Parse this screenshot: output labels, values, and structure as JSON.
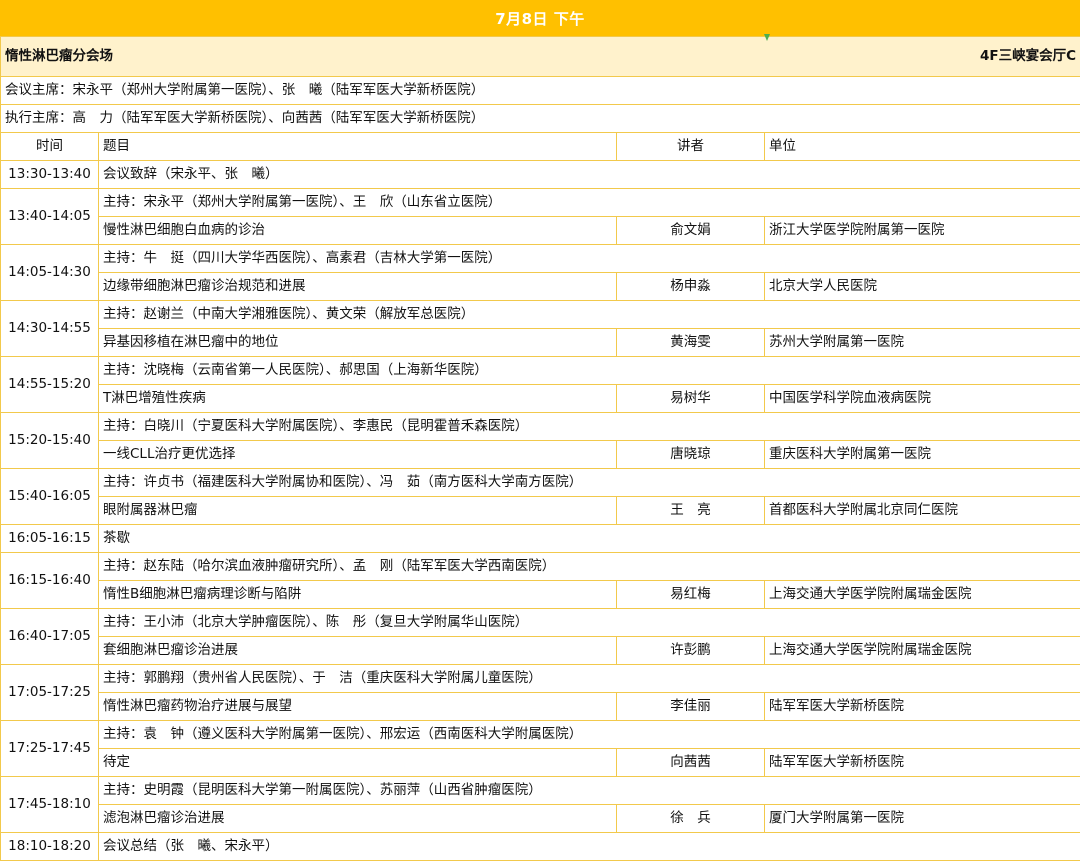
{
  "header": {
    "date_label": "7月8日  下午"
  },
  "session": {
    "title": "惰性淋巴瘤分会场",
    "room": "4F三峡宴会厅C"
  },
  "chairs": {
    "meeting_chairs": "会议主席：宋永平（郑州大学附属第一医院）、张　曦（陆军军医大学新桥医院）",
    "executive_chairs": "执行主席：高　力（陆军军医大学新桥医院）、向茜茜（陆军军医大学新桥医院）"
  },
  "columns": {
    "time": "时间",
    "topic": "题目",
    "speaker": "讲者",
    "unit": "单位"
  },
  "rows": [
    {
      "type": "single",
      "time": "13:30-13:40",
      "text": "会议致辞（宋永平、张　曦）"
    },
    {
      "type": "block",
      "time": "13:40-14:05",
      "host": "主持：宋永平（郑州大学附属第一医院）、王　欣（山东省立医院）",
      "topic": "慢性淋巴细胞白血病的诊治",
      "speaker": "俞文娟",
      "unit": "浙江大学医学院附属第一医院"
    },
    {
      "type": "block",
      "time": "14:05-14:30",
      "host": "主持：牛　挺（四川大学华西医院）、高素君（吉林大学第一医院）",
      "topic": "边缘带细胞淋巴瘤诊治规范和进展",
      "speaker": "杨申淼",
      "unit": "北京大学人民医院"
    },
    {
      "type": "block",
      "time": "14:30-14:55",
      "host": "主持：赵谢兰（中南大学湘雅医院）、黄文荣（解放军总医院）",
      "topic": "异基因移植在淋巴瘤中的地位",
      "speaker": "黄海雯",
      "unit": "苏州大学附属第一医院"
    },
    {
      "type": "block",
      "time": "14:55-15:20",
      "host": "主持：沈晓梅（云南省第一人民医院）、郝思国（上海新华医院）",
      "topic": "T淋巴增殖性疾病",
      "speaker": "易树华",
      "unit": "中国医学科学院血液病医院"
    },
    {
      "type": "block",
      "time": "15:20-15:40",
      "host": "主持：白晓川（宁夏医科大学附属医院）、李惠民（昆明霍普禾森医院）",
      "topic": "一线CLL治疗更优选择",
      "speaker": "唐晓琼",
      "unit": "重庆医科大学附属第一医院"
    },
    {
      "type": "block",
      "time": "15:40-16:05",
      "host": "主持：许贞书（福建医科大学附属协和医院）、冯　茹（南方医科大学南方医院）",
      "topic": "眼附属器淋巴瘤",
      "speaker": "王　亮",
      "unit": "首都医科大学附属北京同仁医院"
    },
    {
      "type": "single",
      "time": "16:05-16:15",
      "text": "茶歇"
    },
    {
      "type": "block",
      "time": "16:15-16:40",
      "host": "主持：赵东陆（哈尔滨血液肿瘤研究所）、孟　刚（陆军军医大学西南医院）",
      "topic": "惰性B细胞淋巴瘤病理诊断与陷阱",
      "speaker": "易红梅",
      "unit": "上海交通大学医学院附属瑞金医院"
    },
    {
      "type": "block",
      "time": "16:40-17:05",
      "host": "主持：王小沛（北京大学肿瘤医院）、陈　彤（复旦大学附属华山医院）",
      "topic": "套细胞淋巴瘤诊治进展",
      "speaker": "许彭鹏",
      "unit": "上海交通大学医学院附属瑞金医院"
    },
    {
      "type": "block",
      "time": "17:05-17:25",
      "host": "主持：郭鹏翔（贵州省人民医院）、于　洁（重庆医科大学附属儿童医院）",
      "topic": "惰性淋巴瘤药物治疗进展与展望",
      "speaker": "李佳丽",
      "unit": "陆军军医大学新桥医院"
    },
    {
      "type": "block",
      "time": "17:25-17:45",
      "host": "主持：袁　钟（遵义医科大学附属第一医院）、邢宏运（西南医科大学附属医院）",
      "topic": "待定",
      "speaker": "向茜茜",
      "unit": "陆军军医大学新桥医院"
    },
    {
      "type": "block",
      "time": "17:45-18:10",
      "host": "主持：史明霞（昆明医科大学第一附属医院）、苏丽萍（山西省肿瘤医院）",
      "topic": "滤泡淋巴瘤诊治进展",
      "speaker": "徐　兵",
      "unit": "厦门大学附属第一医院"
    },
    {
      "type": "single",
      "time": "18:10-18:20",
      "text": "会议总结（张　曦、宋永平）"
    }
  ]
}
